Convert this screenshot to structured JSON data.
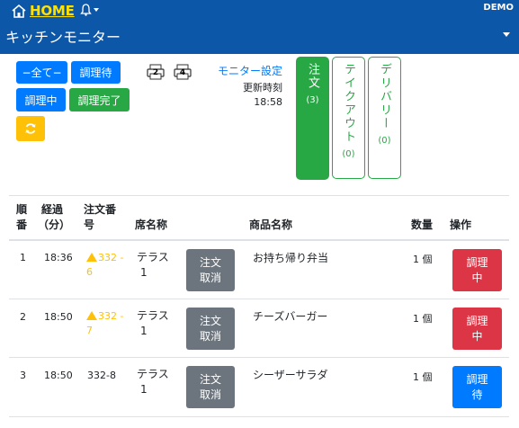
{
  "header": {
    "home_label": "HOME",
    "account": "DEMO",
    "page_title": "キッチンモニター"
  },
  "filters": {
    "all": "−全て−",
    "waiting": "調理待",
    "cooking": "調理中",
    "done": "調理完了"
  },
  "printers": [
    {
      "number": "2"
    },
    {
      "number": "4"
    }
  ],
  "monitor": {
    "settings_label": "モニター設定",
    "update_label": "更新時刻",
    "update_time": "18:58"
  },
  "categories": [
    {
      "label": "注文",
      "count": "(3)",
      "active": true
    },
    {
      "label": "テイクアウト",
      "count": "(0)",
      "active": false
    },
    {
      "label": "デリバリー",
      "count": "(0)",
      "active": false
    }
  ],
  "table": {
    "headers": {
      "order_no_line1": "順",
      "order_no_line2": "番",
      "elapsed_line1": "経過",
      "elapsed_line2": "（分）",
      "order_line1": "注文番",
      "order_line2": "号",
      "seat": "席名称",
      "product": "商品名称",
      "qty": "数量",
      "action": "操作"
    },
    "rows": [
      {
        "no": "1",
        "time": "18:36",
        "order_line1": "332 -",
        "order_line2": "6",
        "warning": true,
        "seat_line1": "テラス",
        "seat_line2": "1",
        "cancel_line1": "注文",
        "cancel_line2": "取消",
        "product": "お持ち帰り弁当",
        "qty": "1 個",
        "action_line1": "調理",
        "action_line2": "中",
        "action_color": "#dc3545"
      },
      {
        "no": "2",
        "time": "18:50",
        "order_line1": "332 -",
        "order_line2": "7",
        "warning": true,
        "seat_line1": "テラス",
        "seat_line2": "1",
        "cancel_line1": "注文",
        "cancel_line2": "取消",
        "product": "チーズバーガー",
        "qty": "1 個",
        "action_line1": "調理",
        "action_line2": "中",
        "action_color": "#dc3545"
      },
      {
        "no": "3",
        "time": "18:50",
        "order_line1": "332-8",
        "order_line2": "",
        "warning": false,
        "seat_line1": "テラス",
        "seat_line2": "1",
        "cancel_line1": "注文",
        "cancel_line2": "取消",
        "product": "シーザーサラダ",
        "qty": "1 個",
        "action_line1": "調理",
        "action_line2": "待",
        "action_color": "#007bff"
      }
    ]
  },
  "colors": {
    "header": "#0d57a8",
    "home_text": "#ffe100",
    "primary": "#007bff",
    "success": "#28a745",
    "warning": "#ffc107",
    "danger": "#dc3545",
    "secondary": "#6c757d"
  }
}
